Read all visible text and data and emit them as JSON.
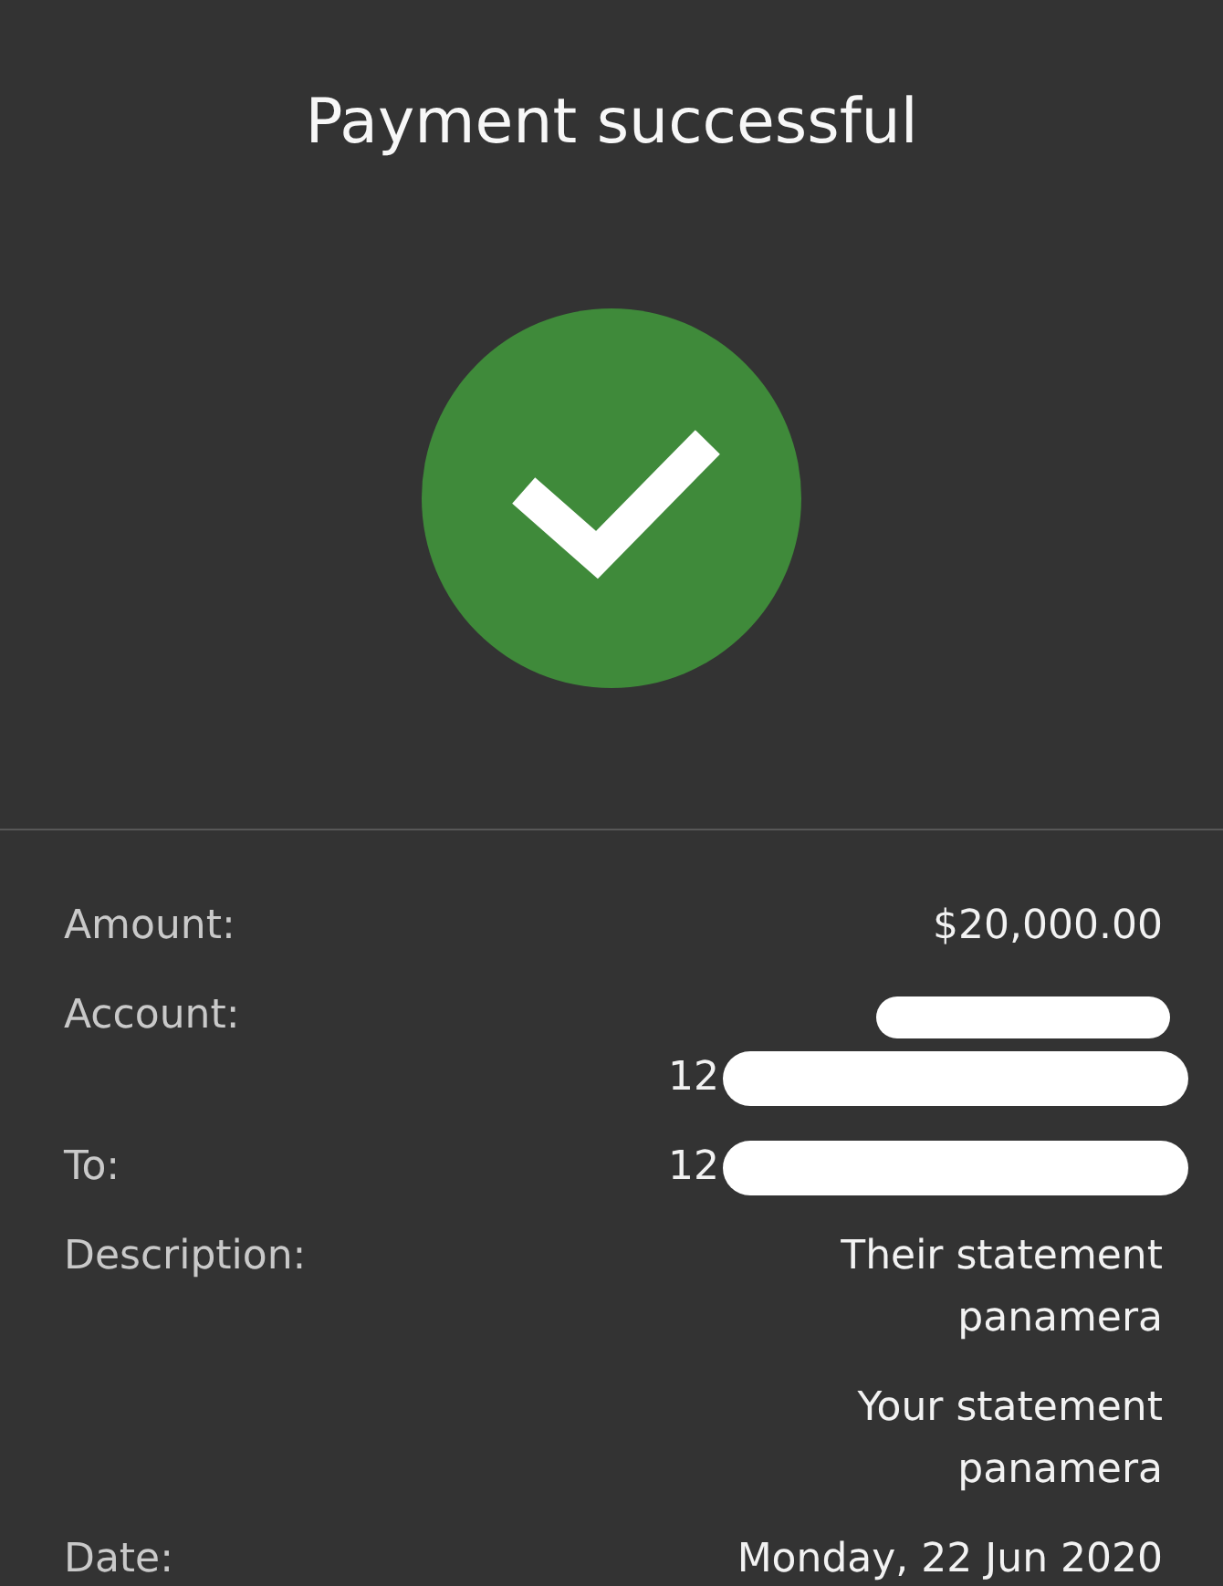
{
  "title": "Payment successful",
  "status": {
    "kind": "success"
  },
  "details": [
    {
      "label": "Amount:",
      "values": [
        {
          "text": "$20,000.00"
        }
      ]
    },
    {
      "label": "Account:",
      "values": [
        {
          "redacted": true
        },
        {
          "text": "12",
          "redacted": true
        }
      ]
    },
    {
      "label": "To:",
      "values": [
        {
          "text": "12",
          "redacted": true
        }
      ]
    },
    {
      "label": "Description:",
      "values": [
        {
          "text": "Their statement panamera"
        },
        {
          "text": "Your statement panamera"
        }
      ]
    },
    {
      "label": "Date:",
      "values": [
        {
          "text": "Monday, 22 Jun 2020"
        }
      ]
    }
  ]
}
